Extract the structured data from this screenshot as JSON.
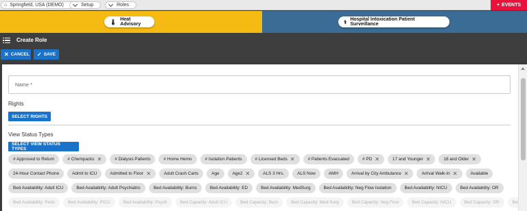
{
  "breadcrumbs": [
    {
      "label": "Springfield, USA (DEMO)"
    },
    {
      "label": "Setup"
    },
    {
      "label": "Roles"
    }
  ],
  "events_label": "EVENTS",
  "alerts": {
    "left": {
      "label": "Heat Advisory",
      "color": "#f6bb13"
    },
    "right": {
      "label": "Hospital Intoxication Patient Surveillance",
      "color": "#3b6c96"
    }
  },
  "page_title": "Create Role",
  "actions": {
    "cancel_label": "CANCEL",
    "save_label": "SAVE"
  },
  "form": {
    "name_placeholder": "Name *",
    "rights_label": "Rights",
    "select_rights_label": "SELECT RIGHTS",
    "view_status_types_label": "View Status Types",
    "select_view_status_types_label": "SELECT VIEW STATUS TYPES"
  },
  "status_type_chips": [
    [
      "# Approved to Return",
      "# Chempacks",
      "# Dialysis Patients",
      "# Home Hemo",
      "# Isolation Patients",
      "# Licensed Beds",
      "# Patients Evacuated",
      "# PD",
      "17 and Younger",
      "18 and Older"
    ],
    [
      "24-Hour Contact Phone",
      "Admit to ICU",
      "Admitted to Floor",
      "Adult Crash Carts",
      "Age",
      "Age2",
      "ALS 3 Hrs.",
      "ALS Now",
      "AMH",
      "Arrival by City Ambulance",
      "Arrival Walk-In",
      "Available"
    ],
    [
      "Bed Availability: Adult ICU",
      "Bed Availability: Adult Psychiatric",
      "Bed Availability: Burns",
      "Bed Availability: ED",
      "Bed Availability: MedSurg",
      "Bed Availability: Neg Flow Isolation",
      "Bed Availability: NICU",
      "Bed Availability: OR"
    ],
    [
      "Bed Availability: Peds",
      "Bed Availability: PICU",
      "Bed Availability: Psych",
      "Bed Capacity: Adult ICU",
      "Bed Capacity: Burn",
      "Bed Capacity: Med-Surg",
      "Bed Capacity: Neg Flow",
      "Bed Capacity: NICU",
      "Bed Capacity: OR",
      "Bed Capacity: Peds"
    ]
  ],
  "chip_removable": [
    [
      false,
      true,
      false,
      false,
      false,
      true,
      false,
      true,
      true,
      true
    ],
    [
      false,
      false,
      true,
      false,
      false,
      true,
      false,
      false,
      false,
      true,
      true,
      false
    ],
    [
      false,
      false,
      false,
      false,
      false,
      false,
      false,
      false
    ],
    [
      false,
      false,
      false,
      false,
      false,
      false,
      false,
      false,
      false,
      false
    ]
  ]
}
